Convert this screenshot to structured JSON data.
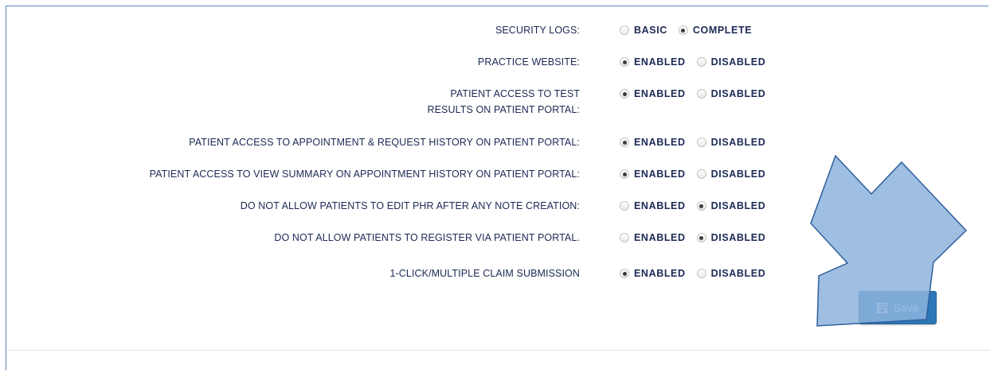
{
  "settings": {
    "rows": [
      {
        "label": "SECURITY LOGS:",
        "options": [
          {
            "label": "BASIC",
            "checked": false
          },
          {
            "label": "COMPLETE",
            "checked": true
          }
        ]
      },
      {
        "label": "PRACTICE WEBSITE:",
        "options": [
          {
            "label": "ENABLED",
            "checked": true
          },
          {
            "label": "DISABLED",
            "checked": false
          }
        ]
      },
      {
        "label_line1": "PATIENT ACCESS TO TEST",
        "label_line2": "RESULTS ON PATIENT PORTAL:",
        "options": [
          {
            "label": "ENABLED",
            "checked": true
          },
          {
            "label": "DISABLED",
            "checked": false
          }
        ]
      },
      {
        "label": "PATIENT ACCESS TO APPOINTMENT & REQUEST HISTORY ON PATIENT PORTAL:",
        "options": [
          {
            "label": "ENABLED",
            "checked": true
          },
          {
            "label": "DISABLED",
            "checked": false
          }
        ]
      },
      {
        "label": "PATIENT ACCESS TO VIEW SUMMARY ON APPOINTMENT HISTORY ON PATIENT PORTAL:",
        "options": [
          {
            "label": "ENABLED",
            "checked": true
          },
          {
            "label": "DISABLED",
            "checked": false
          }
        ]
      },
      {
        "label": "DO NOT ALLOW PATIENTS TO EDIT PHR AFTER ANY NOTE CREATION:",
        "options": [
          {
            "label": "ENABLED",
            "checked": false
          },
          {
            "label": "DISABLED",
            "checked": true
          }
        ]
      },
      {
        "label": "DO NOT ALLOW PATIENTS TO REGISTER VIA PATIENT PORTAL.",
        "options": [
          {
            "label": "ENABLED",
            "checked": false
          },
          {
            "label": "DISABLED",
            "checked": true
          }
        ]
      },
      {
        "label": "1-CLICK/MULTIPLE CLAIM SUBMISSION",
        "options": [
          {
            "label": "ENABLED",
            "checked": true
          },
          {
            "label": "DISABLED",
            "checked": false
          }
        ]
      }
    ]
  },
  "save_button": {
    "label": "Save",
    "icon": "floppy-disk-icon"
  },
  "colors": {
    "label_text": "#1c2a54",
    "button": "#2d77b8",
    "arrow_fill": "#8db3dd",
    "arrow_stroke": "#2f5f9c"
  }
}
